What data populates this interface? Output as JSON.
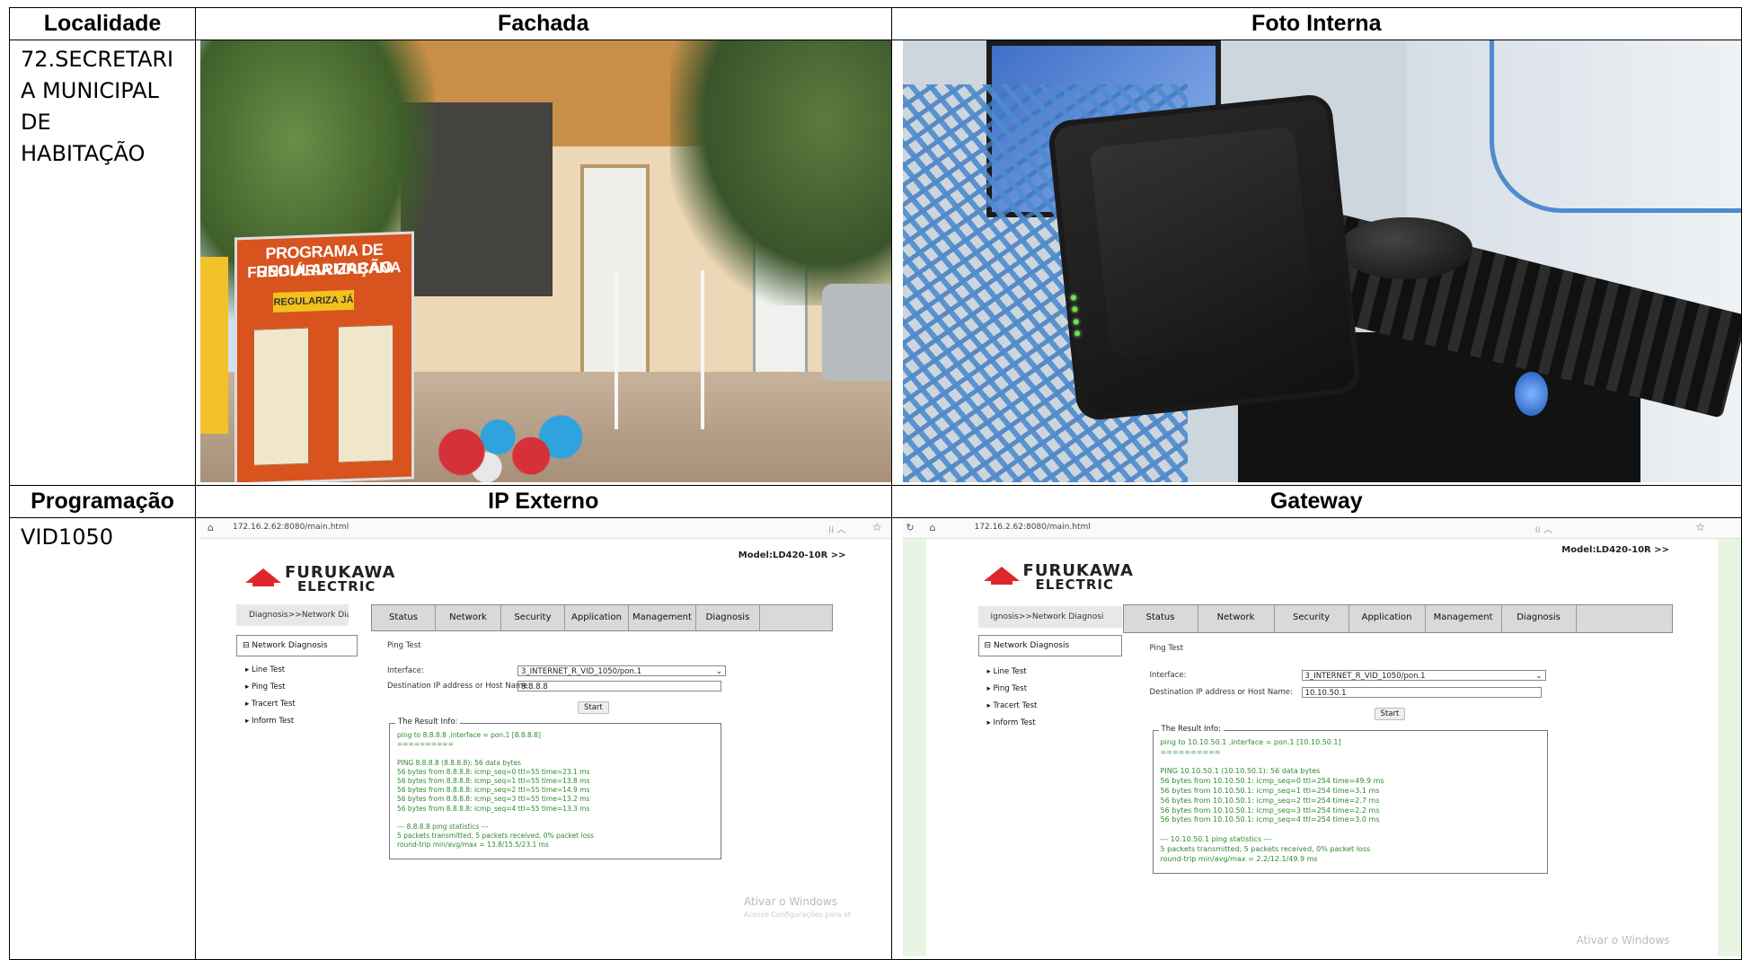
{
  "headers": {
    "localidade": "Localidade",
    "fachada": "Fachada",
    "foto_interna": "Foto Interna",
    "programacao": "Programação",
    "ip_externo": "IP Externo",
    "gateway": "Gateway"
  },
  "localidade_value": [
    "72.SECRETARI",
    "A MUNICIPAL",
    "DE",
    "HABITAÇÃO"
  ],
  "programacao_value": "VID1050",
  "fachada_photo": {
    "sign_line1": "PROGRAMA DE REGULARIZAÇÃO",
    "sign_line2": "FUNDIÁRIA URBANA",
    "sign_badge": "REGULARIZA JÁ"
  },
  "ip_externo_screenshot": {
    "url": "172.16.2.62:8080/main.html",
    "model": "Model:LD420-10R  >>",
    "logo_line1": "FURUKAWA",
    "logo_line2": "ELECTRIC",
    "breadcrumb": "Diagnosis>>Network Diagn",
    "tabs": [
      "Status",
      "Network",
      "Security",
      "Application",
      "Management",
      "Diagnosis"
    ],
    "side_header": "Network Diagnosis",
    "side_items": [
      "Line Test",
      "Ping Test",
      "Tracert Test",
      "Inform Test"
    ],
    "title": "Ping Test",
    "interface_label": "Interface:",
    "interface_value": "3_INTERNET_R_VID_1050/pon.1",
    "dest_label": "Destination IP address or Host Name:",
    "dest_value": "8.8.8.8",
    "start": "Start",
    "result_title": "The Result Info:",
    "result_text": "ping to 8.8.8.8 ,interface = pon.1 [8.8.8.8]\n==========\n\nPING 8.8.8.8 (8.8.8.8): 56 data bytes\n56 bytes from 8.8.8.8: icmp_seq=0 ttl=55 time=23.1 ms\n56 bytes from 8.8.8.8: icmp_seq=1 ttl=55 time=13.8 ms\n56 bytes from 8.8.8.8: icmp_seq=2 ttl=55 time=14.9 ms\n56 bytes from 8.8.8.8: icmp_seq=3 ttl=55 time=13.2 ms\n56 bytes from 8.8.8.8: icmp_seq=4 ttl=55 time=13.3 ms\n\n--- 8.8.8.8 ping statistics ---\n5 packets transmitted, 5 packets received, 0% packet loss\nround-trip min/avg/max = 13.8/15.5/23.1 ms",
    "watermark": "Ativar o Windows",
    "watermark_sub": "Acesse Configurações para at"
  },
  "gateway_screenshot": {
    "url": "172.16.2.62:8080/main.html",
    "model": "Model:LD420-10R  >>",
    "logo_line1": "FURUKAWA",
    "logo_line2": "ELECTRIC",
    "breadcrumb": "ignosis>>Network Diagnosi",
    "tabs": [
      "Status",
      "Network",
      "Security",
      "Application",
      "Management",
      "Diagnosis"
    ],
    "side_header": "Network Diagnosis",
    "side_items": [
      "Line Test",
      "Ping Test",
      "Tracert Test",
      "Inform Test"
    ],
    "title": "Ping Test",
    "interface_label": "Interface:",
    "interface_value": "3_INTERNET_R_VID_1050/pon.1",
    "dest_label": "Destination IP address or Host Name:",
    "dest_value": "10.10.50.1",
    "start": "Start",
    "result_title": "The Result Info:",
    "result_text": "ping to 10.10.50.1 ,interface = pon.1 [10.10.50.1]\n==========\n\nPING 10.10.50.1 (10.10.50.1): 56 data bytes\n56 bytes from 10.10.50.1: icmp_seq=0 ttl=254 time=49.9 ms\n56 bytes from 10.10.50.1: icmp_seq=1 ttl=254 time=3.1 ms\n56 bytes from 10.10.50.1: icmp_seq=2 ttl=254 time=2.7 ms\n56 bytes from 10.10.50.1: icmp_seq=3 ttl=254 time=2.2 ms\n56 bytes from 10.10.50.1: icmp_seq=4 ttl=254 time=3.0 ms\n\n--- 10.10.50.1 ping statistics ---\n5 packets transmitted, 5 packets received, 0% packet loss\nround-trip min/avg/max = 2.2/12.1/49.9 ms",
    "watermark": "Ativar o Windows"
  }
}
